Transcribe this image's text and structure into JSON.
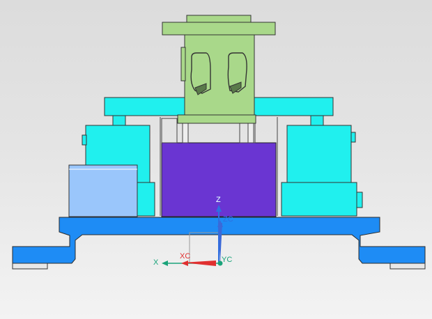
{
  "viewport": {
    "background": [
      "#dcdcdc",
      "#f3f3f3"
    ]
  },
  "colors": {
    "base_plate": "#1e8cf5",
    "cylinder": "#20f0ee",
    "center_block": "#6a35d2",
    "side_block": "#9ac6fb",
    "top_part": "#a9d88a",
    "outline": "#3a3a3a"
  },
  "csys": {
    "work_labels": {
      "z": "Z",
      "x": "X"
    },
    "absolute_labels": {
      "zc": "ZC",
      "xc": "XC",
      "yc": "YC"
    },
    "colors": {
      "z": "#2f6fe0",
      "x": "#1aa37a",
      "xc": "#e03030",
      "yc": "#1aa37a"
    }
  }
}
